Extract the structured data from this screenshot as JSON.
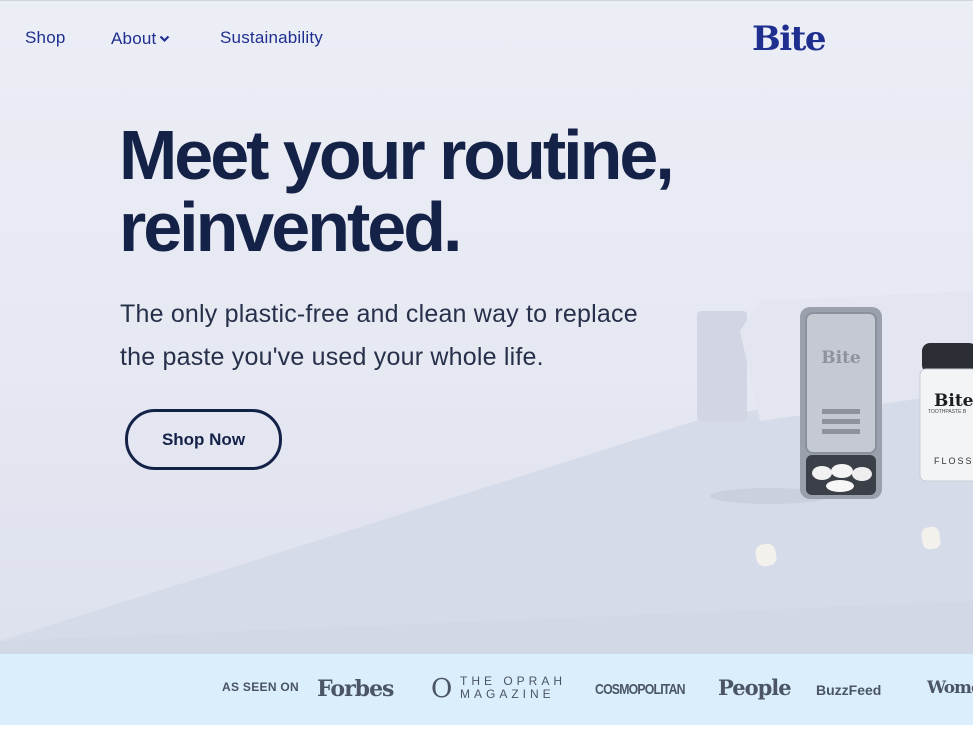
{
  "nav": {
    "links": [
      {
        "label": "Shop"
      },
      {
        "label": "About"
      },
      {
        "label": "Sustainability"
      }
    ],
    "logo": "Bite"
  },
  "hero": {
    "headline_line1": "Meet your routine,",
    "headline_line2": "reinvented.",
    "subhead_line1": "The only plastic-free and clean way to replace",
    "subhead_line2": "the paste you've used your whole life.",
    "cta_label": "Shop Now",
    "product": {
      "tin_brand": "Bite",
      "floss_brand": "Bite",
      "floss_label": "FLOSS",
      "floss_sub": "TOOTHPASTE B"
    }
  },
  "press": {
    "label": "AS SEEN ON",
    "logos": [
      "Forbes",
      "O",
      "THE OPRAH",
      "MAGAZINE",
      "COSMOPOLITAN",
      "People",
      "BuzzFeed",
      "Women's"
    ]
  },
  "colors": {
    "brand_blue": "#1f2f8f",
    "navy_text": "#152248",
    "press_bg": "#daeefb"
  }
}
